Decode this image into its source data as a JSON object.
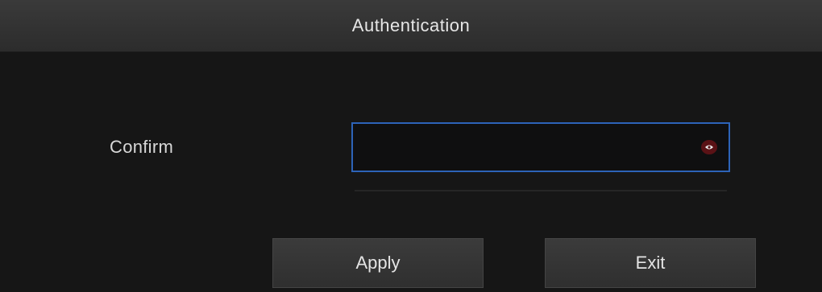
{
  "dialog": {
    "title": "Authentication",
    "confirm_label": "Confirm",
    "password_value": "",
    "password_placeholder": "",
    "eye_icon": "eye-icon",
    "apply_label": "Apply",
    "exit_label": "Exit"
  },
  "colors": {
    "background": "#161616",
    "title_bar": "#333333",
    "input_border_focus": "#2d63b8",
    "button_bg": "#353535",
    "text": "#e0e0e0"
  }
}
